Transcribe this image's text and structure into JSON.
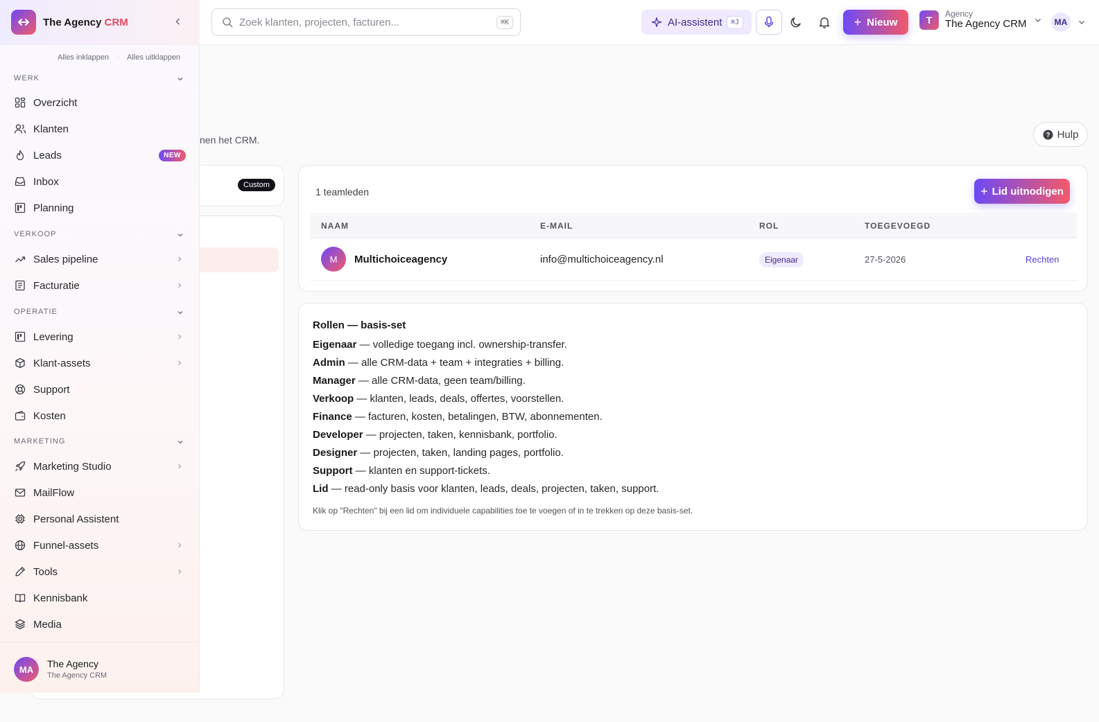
{
  "brand": {
    "name": "The Agency",
    "name_accent": "CRM"
  },
  "topbar": {
    "search_placeholder": "Zoek klanten, projecten, facturen...",
    "search_shortcut": "⌘K",
    "ai_label": "AI-assistent",
    "ai_shortcut": "⌘J",
    "new_label": "Nieuw",
    "workspace_small": "Agency",
    "workspace_name": "The Agency CRM",
    "workspace_initial": "T",
    "user_initials": "MA"
  },
  "sidebar": {
    "collapse_all": "Alles inklappen",
    "separator": "·",
    "expand_all": "Alles uitklappen",
    "sections": {
      "werk": "WERK",
      "verkoop": "VERKOOP",
      "operatie": "OPERATIE",
      "marketing": "MARKETING"
    },
    "items": {
      "overzicht": "Overzicht",
      "klanten": "Klanten",
      "leads": "Leads",
      "leads_badge": "NEW",
      "inbox": "Inbox",
      "planning": "Planning",
      "sales_pipeline": "Sales pipeline",
      "facturatie": "Facturatie",
      "levering": "Levering",
      "klant_assets": "Klant-assets",
      "support": "Support",
      "kosten": "Kosten",
      "marketing_studio": "Marketing Studio",
      "mailflow": "MailFlow",
      "personal_assistent": "Personal Assistent",
      "funnel_assets": "Funnel-assets",
      "tools": "Tools",
      "kennisbank": "Kennisbank",
      "media": "Media"
    },
    "footer": {
      "initials": "MA",
      "name": "The Agency",
      "sub": "The Agency CRM"
    }
  },
  "page": {
    "subtitle_fragment": "nen het CRM.",
    "help_label": "Hulp",
    "custom_pill": "Custom"
  },
  "team": {
    "count_label": "1 teamleden",
    "invite_label": "Lid uitnodigen",
    "columns": {
      "name": "NAAM",
      "email": "E-MAIL",
      "role": "ROL",
      "added": "TOEGEVOEGD"
    },
    "rows": [
      {
        "initial": "M",
        "name": "Multichoiceagency",
        "email": "info@multichoiceagency.nl",
        "role": "Eigenaar",
        "added": "27-5-2026",
        "action": "Rechten"
      }
    ]
  },
  "roles": {
    "title": "Rollen — basis-set",
    "items": [
      {
        "name": "Eigenaar",
        "desc": " — volledige toegang incl. ownership-transfer."
      },
      {
        "name": "Admin",
        "desc": " — alle CRM-data + team + integraties + billing."
      },
      {
        "name": "Manager",
        "desc": " — alle CRM-data, geen team/billing."
      },
      {
        "name": "Verkoop",
        "desc": " — klanten, leads, deals, offertes, voorstellen."
      },
      {
        "name": "Finance",
        "desc": " — facturen, kosten, betalingen, BTW, abonnementen."
      },
      {
        "name": "Developer",
        "desc": " — projecten, taken, kennisbank, portfolio."
      },
      {
        "name": "Designer",
        "desc": " — projecten, taken, landing pages, portfolio."
      },
      {
        "name": "Support",
        "desc": " — klanten en support-tickets."
      },
      {
        "name": "Lid",
        "desc": " — read-only basis voor klanten, leads, deals, projecten, taken, support."
      }
    ],
    "note": "Klik op \"Rechten\" bij een lid om individuele capabilities toe te voegen of in te trekken op deze basis-set."
  },
  "colors": {
    "accent_purple": "#6d4af5",
    "accent_coral": "#f25a6a",
    "link": "#5b3fd9"
  }
}
